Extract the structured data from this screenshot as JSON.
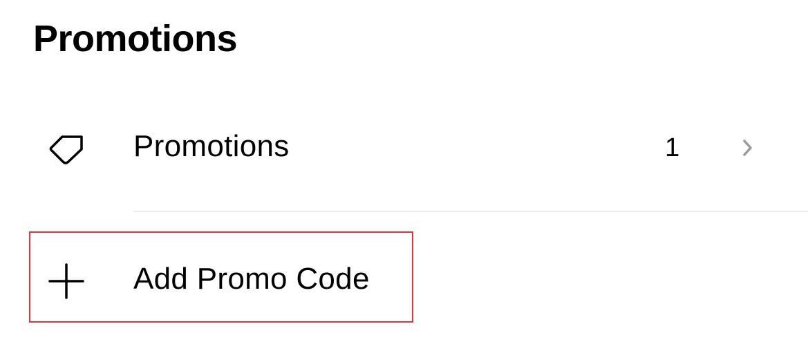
{
  "header": {
    "title": "Promotions"
  },
  "rows": {
    "promotions": {
      "label": "Promotions",
      "count": "1",
      "icon": "tag-icon",
      "trailing_icon": "chevron-right-icon"
    },
    "add_promo": {
      "label": "Add Promo Code",
      "icon": "plus-icon"
    }
  },
  "colors": {
    "highlight_border": "#e0343f",
    "divider": "#ececec",
    "chevron": "#9a9a9a",
    "text": "#000000"
  }
}
